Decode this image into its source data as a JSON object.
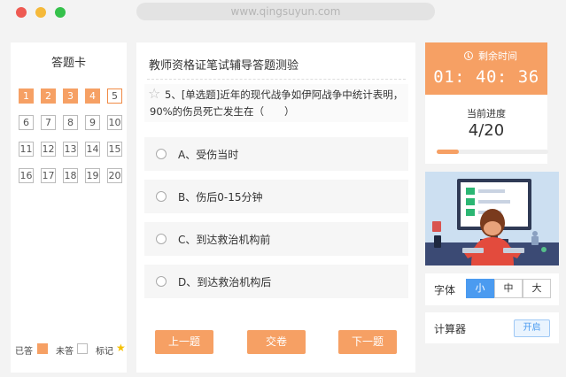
{
  "browser": {
    "url": "www.qingsuyun.com"
  },
  "answer_card": {
    "title": "答题卡",
    "numbers": [
      "1",
      "2",
      "3",
      "4",
      "5",
      "6",
      "7",
      "8",
      "9",
      "10",
      "11",
      "12",
      "13",
      "14",
      "15",
      "16",
      "17",
      "18",
      "19",
      "20"
    ],
    "answered_count": 4,
    "current_index": 5,
    "legend": {
      "answered": "已答",
      "unanswered": "未答",
      "marked": "标记"
    }
  },
  "exam": {
    "title": "教师资格证笔试辅导答题测验",
    "question": "5、[单选题]近年的现代战争如伊阿战争中统计表明，90%的伤员死亡发生在（　　）",
    "options": [
      {
        "label": "A、受伤当时"
      },
      {
        "label": "B、伤后0-15分钟"
      },
      {
        "label": "C、到达救治机构前"
      },
      {
        "label": "D、到达救治机构后"
      }
    ],
    "buttons": {
      "prev": "上一题",
      "submit": "交卷",
      "next": "下一题"
    }
  },
  "timer": {
    "label": "剩余时间",
    "value": "01: 40: 36",
    "progress_label": "当前进度",
    "progress_value": "4/20",
    "progress_fraction": 0.2
  },
  "font_size": {
    "label": "字体",
    "options": [
      "小",
      "中",
      "大"
    ],
    "selected": "小"
  },
  "calculator": {
    "label": "计算器",
    "button": "开启"
  },
  "colors": {
    "accent": "#f6a064",
    "blue": "#4b9bf0"
  }
}
